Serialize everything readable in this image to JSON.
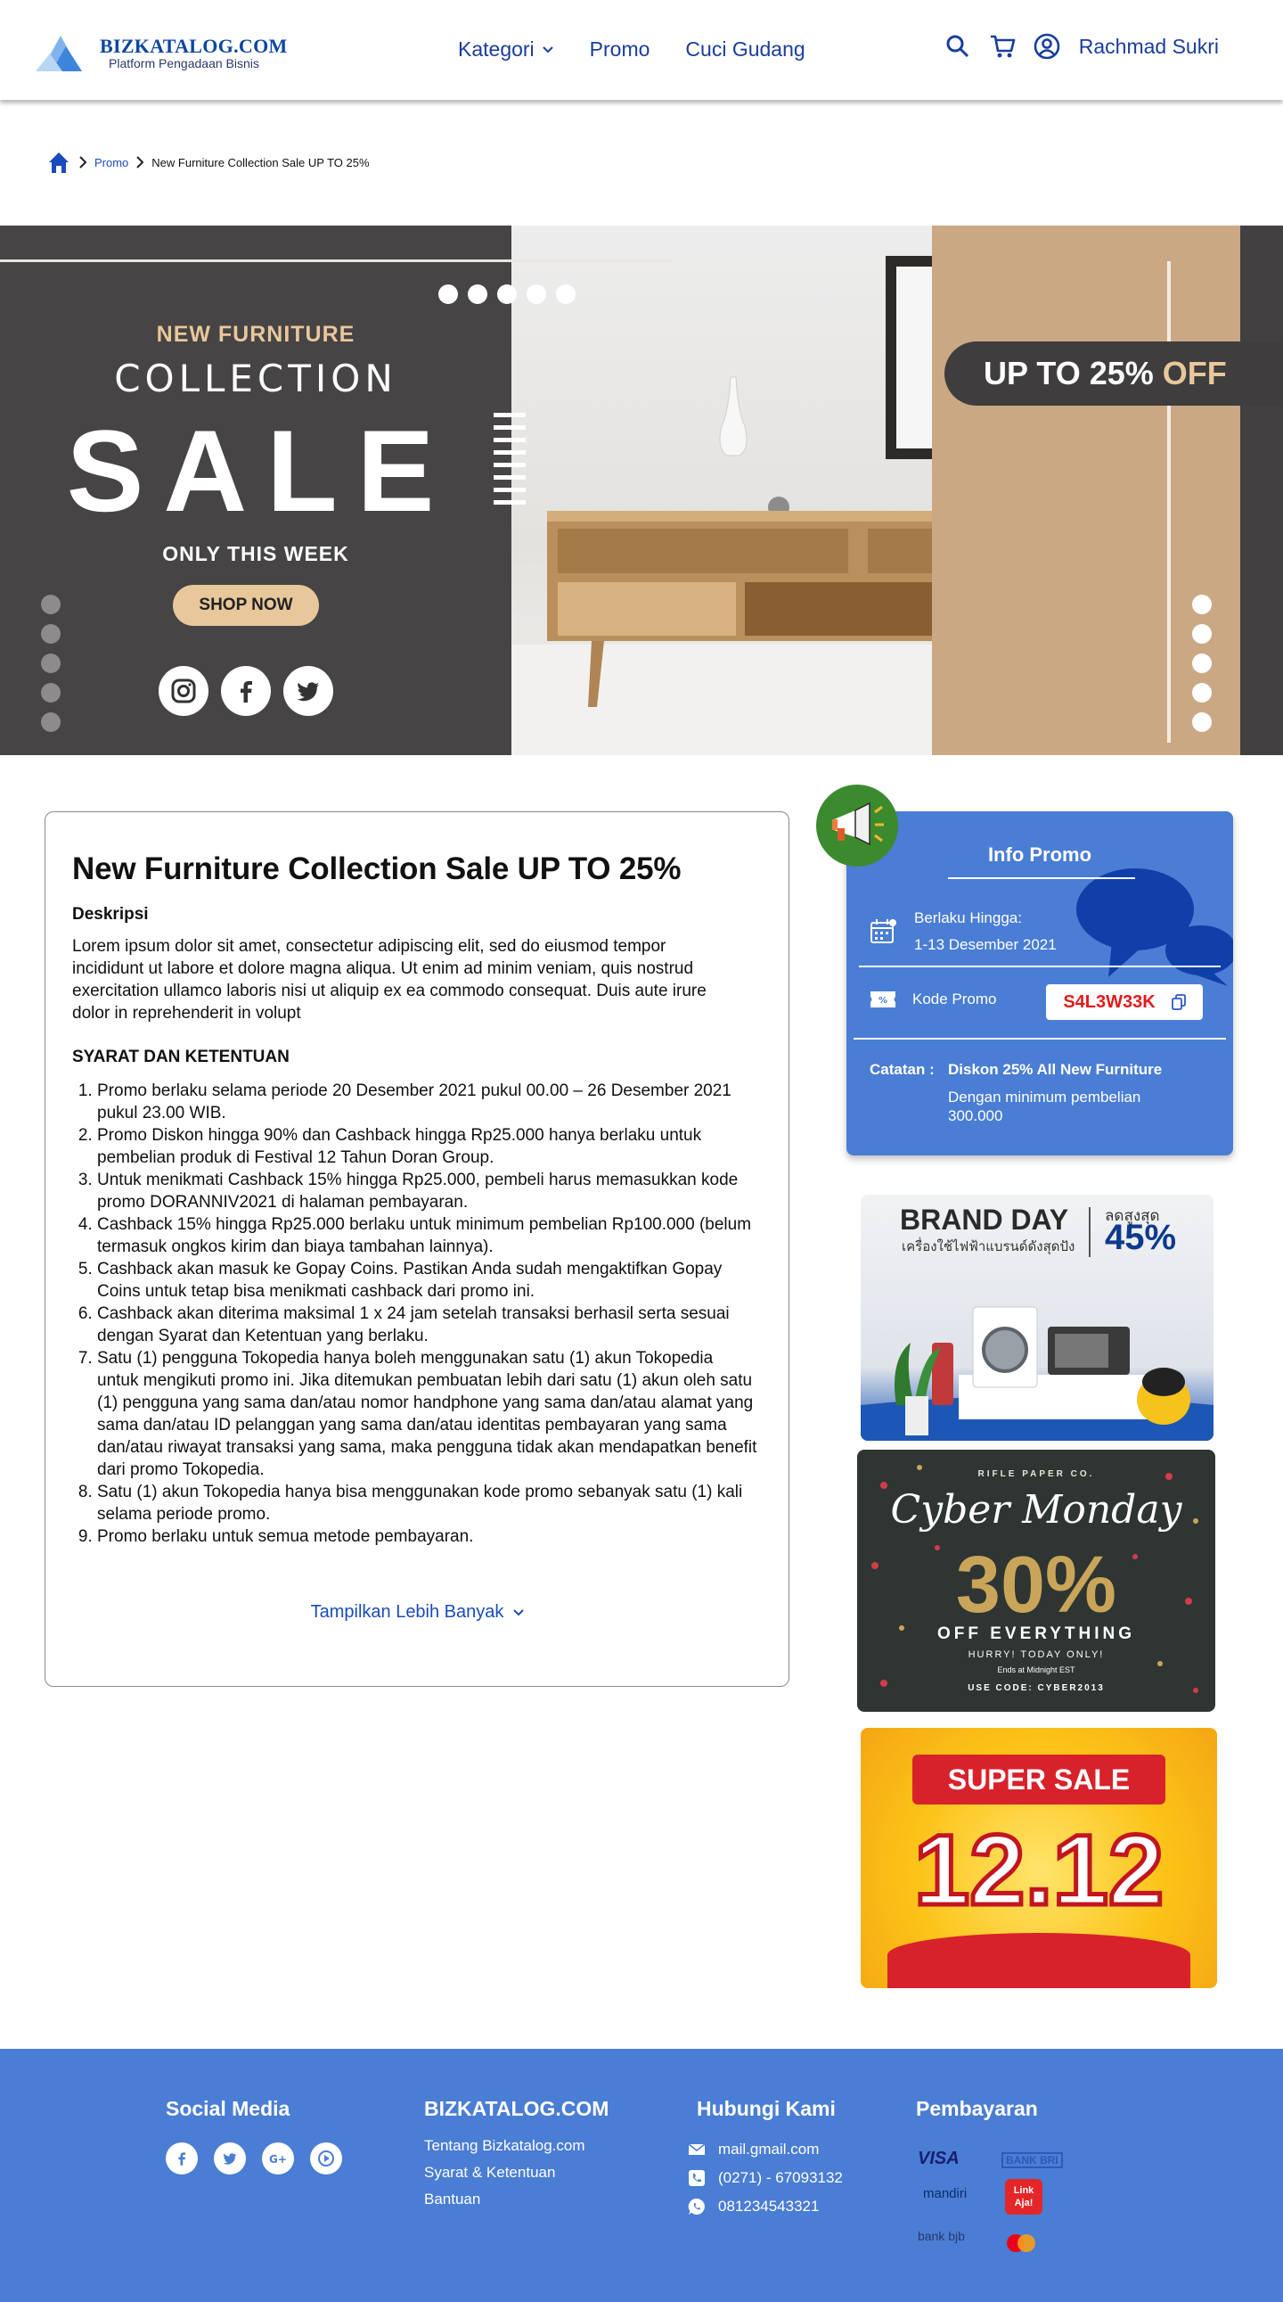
{
  "header": {
    "logo_title": "BIZKATALOG.COM",
    "logo_subtitle": "Platform Pengadaan Bisnis",
    "nav": [
      {
        "label": "Kategori"
      },
      {
        "label": "Promo"
      },
      {
        "label": "Cuci Gudang"
      }
    ],
    "user_name": "Rachmad Sukri",
    "icons": [
      "search-icon",
      "cart-icon",
      "user-icon"
    ]
  },
  "breadcrumb": {
    "items": [
      "Promo"
    ],
    "current": "New Furniture Collection Sale UP TO 25%"
  },
  "hero": {
    "line1": "NEW FURNITURE",
    "line2": "COLLECTION",
    "line3": "SALE",
    "line4": "ONLY THIS WEEK",
    "button": "SHOP NOW",
    "badge_main": "UP TO 25%",
    "badge_off": "OFF"
  },
  "promo": {
    "title": "New Furniture Collection Sale UP TO 25%",
    "desc_label": "Deskripsi",
    "description": "Lorem ipsum dolor sit amet, consectetur adipiscing elit, sed do eiusmod tempor incididunt ut labore et dolore magna aliqua. Ut enim ad minim veniam, quis nostrud exercitation ullamco laboris nisi ut aliquip ex ea commodo consequat. Duis aute irure dolor in reprehenderit in volupt",
    "terms_title": "SYARAT DAN KETENTUAN",
    "terms": [
      "Promo berlaku selama periode 20 Desember 2021 pukul 00.00 – 26 Desember 2021 pukul 23.00 WIB.",
      "Promo Diskon hingga 90% dan Cashback hingga Rp25.000 hanya berlaku untuk pembelian produk di Festival 12 Tahun Doran Group.",
      "Untuk menikmati Cashback 15% hingga Rp25.000, pembeli harus memasukkan kode promo DORANNIV2021 di halaman pembayaran.",
      "Cashback 15% hingga Rp25.000 berlaku untuk minimum pembelian Rp100.000 (belum termasuk ongkos kirim dan biaya tambahan lainnya).",
      "Cashback akan masuk ke Gopay Coins. Pastikan Anda sudah mengaktifkan Gopay Coins untuk tetap bisa menikmati cashback dari promo ini.",
      "Cashback akan diterima maksimal 1 x 24 jam setelah transaksi berhasil serta sesuai dengan Syarat dan Ketentuan yang berlaku.",
      "Satu (1) pengguna Tokopedia hanya boleh menggunakan satu (1) akun Tokopedia untuk mengikuti promo ini. Jika ditemukan pembuatan lebih dari satu (1) akun oleh satu (1) pengguna yang sama dan/atau nomor handphone yang sama dan/atau alamat yang sama dan/atau ID pelanggan yang sama dan/atau identitas pembayaran yang sama dan/atau riwayat transaksi yang sama, maka pengguna tidak akan mendapatkan benefit dari promo Tokopedia.",
      "Satu (1) akun Tokopedia hanya bisa menggunakan kode promo sebanyak satu (1) kali selama periode promo.",
      "Promo berlaku untuk semua metode pembayaran."
    ],
    "show_more": "Tampilkan Lebih Banyak"
  },
  "info_promo": {
    "title": "Info Promo",
    "valid_label": "Berlaku Hingga:",
    "valid_value": "1-13 Desember 2021",
    "code_label": "Kode Promo",
    "code": "S4L3W33K",
    "note_label": "Catatan :",
    "note_head": "Diskon 25% All New Furniture",
    "note_body": "Dengan minimum pembelian 300.000"
  },
  "banners": {
    "brand_day": {
      "title": "BRAND DAY",
      "sub": "เครื่องใช้ไฟฟ้าแบรนด์ดังสุดปัง",
      "small": "ลดสูงสุด",
      "pct": "45%"
    },
    "cyber": {
      "brand": "RIFLE PAPER CO.",
      "title": "Cyber Monday",
      "pct": "30%",
      "off": "OFF EVERYTHING",
      "l1": "HURRY! TODAY ONLY!",
      "l2": "Ends at Midnight EST",
      "l3": "USE CODE: CYBER2013"
    },
    "super_sale": {
      "ribbon": "SUPER SALE",
      "num": "12.12"
    }
  },
  "footer": {
    "social_title": "Social Media",
    "company_title": "BIZKATALOG.COM",
    "company_links": [
      "Tentang Bizkatalog.com",
      "Syarat & Ketentuan",
      "Bantuan"
    ],
    "contact_title": "Hubungi Kami",
    "email": "mail.gmail.com",
    "phone": "(0271) - 67093132",
    "whatsapp": "081234543321",
    "payment_title": "Pembayaran",
    "payments": [
      "VISA",
      "BANK BRI",
      "mandiri",
      "Link Aja!",
      "bank bjb",
      "mastercard"
    ]
  },
  "colors": {
    "brand_blue": "#1a3d9e",
    "panel_blue": "#4a7dd4",
    "code_red": "#e21b1b"
  }
}
